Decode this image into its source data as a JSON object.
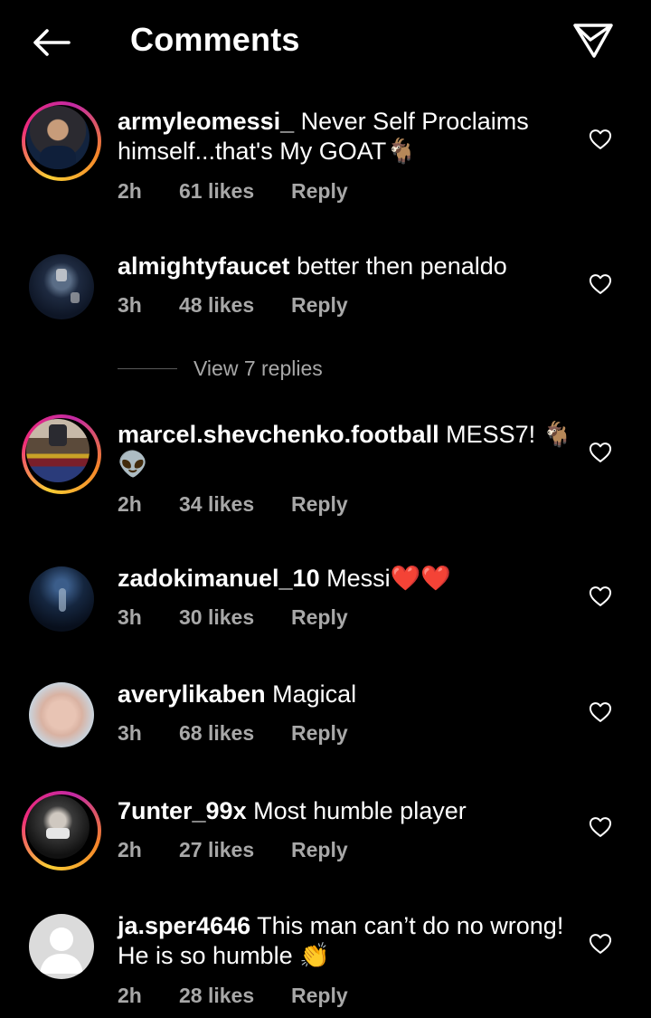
{
  "header": {
    "title": "Comments",
    "back_icon": "back-arrow-icon",
    "send_icon": "send-icon"
  },
  "comments": [
    {
      "username": "armyleomessi_",
      "text": "Never Self Proclaims himself...that's My GOAT🐐",
      "time": "2h",
      "likes": "61 likes",
      "reply": "Reply"
    },
    {
      "username": "almightyfaucet",
      "text": "better then penaldo",
      "time": "3h",
      "likes": "48 likes",
      "reply": "Reply"
    },
    {
      "username": "marcel.shevchenko.football",
      "text": "MESS7! 🐐 👽",
      "time": "2h",
      "likes": "34 likes",
      "reply": "Reply"
    },
    {
      "username": "zadokimanuel_10",
      "text": "Messi❤️❤️",
      "time": "3h",
      "likes": "30 likes",
      "reply": "Reply"
    },
    {
      "username": "averylikaben",
      "text": "Magical",
      "time": "3h",
      "likes": "68 likes",
      "reply": "Reply"
    },
    {
      "username": "7unter_99x",
      "text": "Most humble player",
      "time": "2h",
      "likes": "27 likes",
      "reply": "Reply"
    },
    {
      "username": "ja.sper4646",
      "text": "This man can’t do no wrong! He is so humble 👏",
      "time": "2h",
      "likes": "28 likes",
      "reply": "Reply"
    }
  ],
  "view_replies": "View 7 replies",
  "colors": {
    "background": "#000000",
    "text": "#ffffff",
    "secondary": "#a8a8a8",
    "story_ring_start": "#f9ce34",
    "story_ring_end": "#ee2a7b"
  }
}
